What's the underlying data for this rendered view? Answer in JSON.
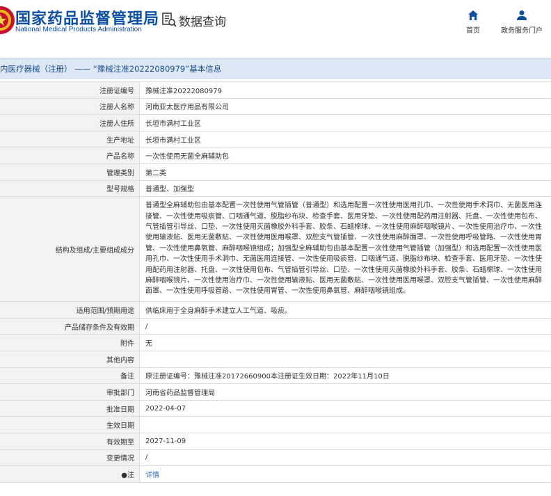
{
  "header": {
    "brand_cn": "国家药品监督管理局",
    "brand_en": "National Medical Products Administration",
    "section_title": "数据查询",
    "nav": [
      {
        "label": "首页",
        "icon": "home-icon"
      },
      {
        "label": "政务服务门户",
        "icon": "user-icon"
      }
    ]
  },
  "title_bar": "内医疗器械（注册） —— “豫械注准20222080979”基本信息",
  "colors": {
    "brand": "#0f4fa3",
    "titlebar_bg": "#dde8f5",
    "label_bg": "#f2f2f2",
    "link": "#2b6cc4"
  },
  "rows": [
    {
      "label": "注册证编号",
      "value": "豫械注准20222080979"
    },
    {
      "label": "注册人名称",
      "value": "河南亚太医疗用品有限公司"
    },
    {
      "label": "注册人住所",
      "value": "长垣市满村工业区"
    },
    {
      "label": "生产地址",
      "value": "长垣市满村工业区"
    },
    {
      "label": "产品名称",
      "value": "一次性使用无菌全麻辅助包"
    },
    {
      "label": "管理类别",
      "value": "第二类"
    },
    {
      "label": "型号规格",
      "value": "普通型、加强型"
    },
    {
      "label": "结构及组成/主要组成成分",
      "value": "普通型全麻辅助包由基本配置一次性使用气管插管（普通型）和选用配置一次性使用医用孔巾、一次性使用手术洞巾、无菌医用连接管、一次性使用吸痰管、口咽通气道、脱脂纱布块、检查手套、医用牙垫、一次性使用配药用注射器、托盘、一次性使用包布、气管插管引导丝、口垫、一次性使用灭菌橡胶外科手套、胶条、石蜡棉球、一次性使用麻醉咽喉镜片、一次性使用治疗巾、一次性使用输液贴、医用无菌敷贴、一次性使用医用喉罩、双腔支气管插管、一次性使用麻醉面罩、一次性使用呼吸管路、一次性使用胃管、一次性使用鼻氧管、麻醉咽喉镜组成；加强型全麻辅助包由基本配置一次性使用气管插管（加强型）和选用配置一次性使用医用孔巾、一次性使用手术洞巾、无菌医用连接管、一次性使用吸痰管、口咽通气道、脱脂纱布块、检查手套、医用牙垫、一次性使用配药用注射器、托盘、一次性使用包布、气管插管引导丝、口垫、一次性使用灭菌橡胶外科手套、胶条、石蜡棉球、一次性使用麻醉咽喉镜片、一次性使用治疗巾、一次性使用输液贴、医用无菌敷贴、一次性使用医用喉罩、双腔支气管插管、一次性使用麻醉面罩、一次性使用呼吸管路、一次性使用胃管、一次性使用鼻氧管、麻醉咽喉镜组成。"
    },
    {
      "label": "适用范围/预期用途",
      "value": "供临床用于全身麻醉手术建立人工气道、吸痰。"
    },
    {
      "label": "产品储存条件及有效期",
      "value": "/"
    },
    {
      "label": "附件",
      "value": "无"
    },
    {
      "label": "其他内容",
      "value": ""
    },
    {
      "label": "备注",
      "value": "原注册证编号：豫械注准20172660900本注册证生效日期：2022年11月10日"
    },
    {
      "label": "审批部门",
      "value": "河南省药品监督管理局"
    },
    {
      "label": "批准日期",
      "value": "2022-04-07"
    },
    {
      "label": "生效日期",
      "value": ""
    },
    {
      "label": "有效期至",
      "value": "2027-11-09"
    },
    {
      "label": "变更情况",
      "value": "/"
    },
    {
      "label": "●注",
      "value": "详情"
    }
  ]
}
